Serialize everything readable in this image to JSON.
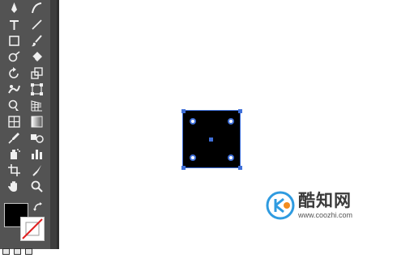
{
  "toolbar": {
    "tools": [
      {
        "name": "pen-tool-icon"
      },
      {
        "name": "curvature-tool-icon"
      },
      {
        "name": "type-tool-icon"
      },
      {
        "name": "line-segment-tool-icon"
      },
      {
        "name": "rectangle-tool-icon"
      },
      {
        "name": "paintbrush-tool-icon"
      },
      {
        "name": "shaper-tool-icon"
      },
      {
        "name": "eraser-tool-icon"
      },
      {
        "name": "rotate-tool-icon"
      },
      {
        "name": "scale-tool-icon"
      },
      {
        "name": "warp-tool-icon"
      },
      {
        "name": "free-transform-tool-icon"
      },
      {
        "name": "shape-builder-tool-icon"
      },
      {
        "name": "perspective-grid-tool-icon"
      },
      {
        "name": "mesh-tool-icon"
      },
      {
        "name": "gradient-tool-icon"
      },
      {
        "name": "eyedropper-tool-icon"
      },
      {
        "name": "blend-tool-icon"
      },
      {
        "name": "symbol-sprayer-tool-icon"
      },
      {
        "name": "column-graph-tool-icon"
      },
      {
        "name": "artboard-tool-icon"
      },
      {
        "name": "slice-tool-icon"
      },
      {
        "name": "hand-tool-icon"
      },
      {
        "name": "zoom-tool-icon"
      }
    ],
    "fill_color": "#000000",
    "stroke_color": "none"
  },
  "selection": {
    "color": "#3f6fd8"
  },
  "watermark": {
    "name": "酷知网",
    "url": "www.coozhi.com"
  }
}
